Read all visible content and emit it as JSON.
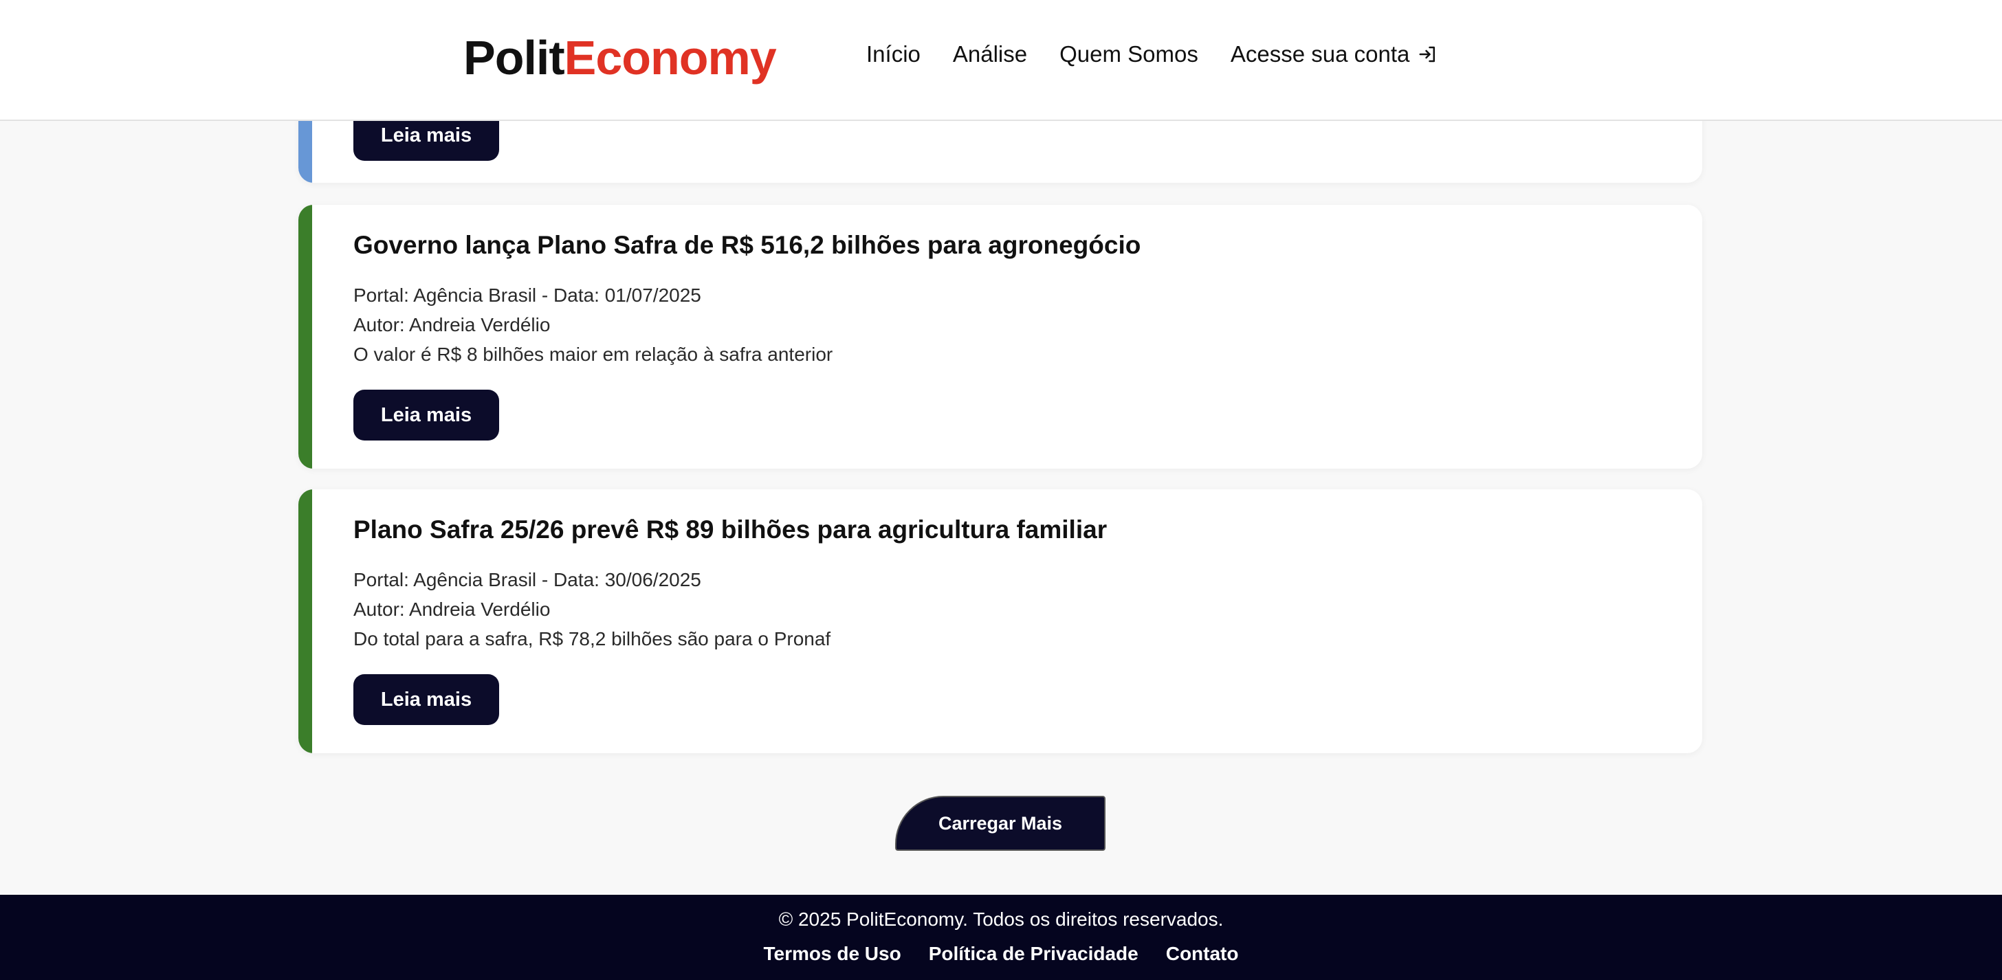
{
  "header": {
    "logo_part1": "Polit",
    "logo_part2": "Economy",
    "nav": [
      "Início",
      "Análise",
      "Quem Somos",
      "Acesse sua conta"
    ],
    "login_icon": "login-icon"
  },
  "cards": [
    {
      "accent": "#6797d6",
      "button": "Leia mais"
    },
    {
      "accent": "#3b7e2a",
      "title": "Governo lança Plano Safra de R$ 516,2 bilhões para agronegócio",
      "portal": "Portal: Agência Brasil - Data: 01/07/2025",
      "author": "Autor: Andreia Verdélio",
      "summary": "O valor é R$ 8 bilhões maior em relação à safra anterior",
      "button": "Leia mais"
    },
    {
      "accent": "#3b7e2a",
      "title": "Plano Safra 25/26 prevê R$ 89 bilhões para agricultura familiar",
      "portal": "Portal: Agência Brasil - Data: 30/06/2025",
      "author": "Autor: Andreia Verdélio",
      "summary": "Do total para a safra, R$ 78,2 bilhões são para o Pronaf",
      "button": "Leia mais"
    }
  ],
  "load_more": "Carregar Mais",
  "footer": {
    "copyright": "© 2025 PolitEconomy. Todos os direitos reservados.",
    "links": [
      "Termos de Uso",
      "Política de Privacidade",
      "Contato"
    ]
  }
}
